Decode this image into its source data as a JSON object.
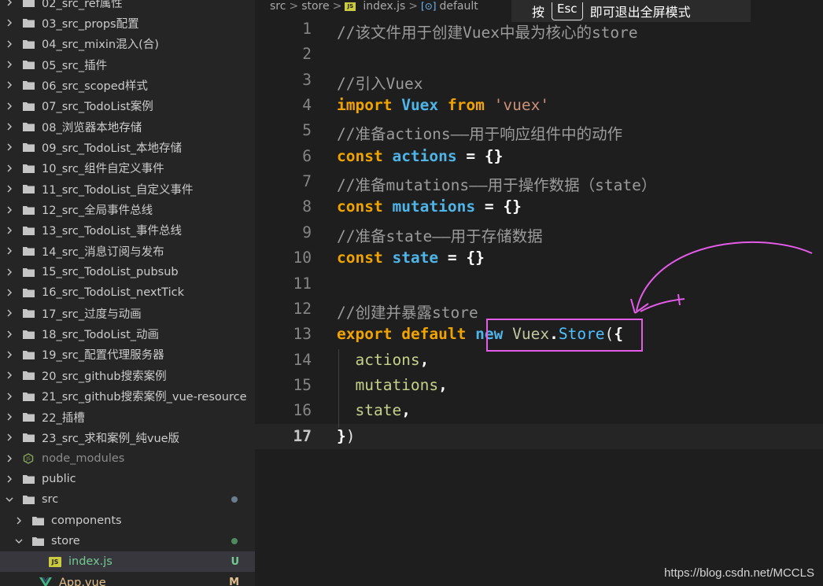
{
  "explorer": {
    "items": [
      {
        "label": "02_src_ref属性",
        "type": "folder",
        "expanded": false
      },
      {
        "label": "03_src_props配置",
        "type": "folder",
        "expanded": false
      },
      {
        "label": "04_src_mixin混入(合)",
        "type": "folder",
        "expanded": false
      },
      {
        "label": "05_src_插件",
        "type": "folder",
        "expanded": false
      },
      {
        "label": "06_src_scoped样式",
        "type": "folder",
        "expanded": false
      },
      {
        "label": "07_src_TodoList案例",
        "type": "folder",
        "expanded": false
      },
      {
        "label": "08_浏览器本地存储",
        "type": "folder",
        "expanded": false
      },
      {
        "label": "09_src_TodoList_本地存储",
        "type": "folder",
        "expanded": false
      },
      {
        "label": "10_src_组件自定义事件",
        "type": "folder",
        "expanded": false
      },
      {
        "label": "11_src_TodoList_自定义事件",
        "type": "folder",
        "expanded": false
      },
      {
        "label": "12_src_全局事件总线",
        "type": "folder",
        "expanded": false
      },
      {
        "label": "13_src_TodoList_事件总线",
        "type": "folder",
        "expanded": false
      },
      {
        "label": "14_src_消息订阅与发布",
        "type": "folder",
        "expanded": false
      },
      {
        "label": "15_src_TodoList_pubsub",
        "type": "folder",
        "expanded": false
      },
      {
        "label": "16_src_TodoList_nextTick",
        "type": "folder",
        "expanded": false
      },
      {
        "label": "17_src_过度与动画",
        "type": "folder",
        "expanded": false
      },
      {
        "label": "18_src_TodoList_动画",
        "type": "folder",
        "expanded": false
      },
      {
        "label": "19_src_配置代理服务器",
        "type": "folder",
        "expanded": false
      },
      {
        "label": "20_src_github搜索案例",
        "type": "folder",
        "expanded": false
      },
      {
        "label": "21_src_github搜索案例_vue-resource",
        "type": "folder",
        "expanded": false
      },
      {
        "label": "22_插槽",
        "type": "folder",
        "expanded": false
      },
      {
        "label": "23_src_求和案例_纯vue版",
        "type": "folder",
        "expanded": false
      },
      {
        "label": "node_modules",
        "type": "folder-special",
        "expanded": false
      },
      {
        "label": "public",
        "type": "folder",
        "expanded": false
      },
      {
        "label": "src",
        "type": "folder",
        "expanded": true,
        "status": "dot"
      },
      {
        "label": "components",
        "type": "folder",
        "expanded": false,
        "depth": 1
      },
      {
        "label": "store",
        "type": "folder",
        "expanded": true,
        "depth": 1,
        "status": "dot-green"
      },
      {
        "label": "index.js",
        "type": "js",
        "depth": 2,
        "badge": "U",
        "selected": true
      },
      {
        "label": "App.vue",
        "type": "vue",
        "depth": 1,
        "badge": "M"
      }
    ],
    "status_colors": {
      "U": "#73c991",
      "M": "#e2c08d",
      "dot": "#6a7d8c",
      "dot-green": "#4f8a5f"
    }
  },
  "breadcrumb": {
    "parts": [
      "src",
      "store",
      "index.js",
      "default"
    ],
    "js_badge": "JS"
  },
  "fullscreen_hint": {
    "before": "按",
    "key": "Esc",
    "after": "即可退出全屏模式"
  },
  "code": {
    "active_line": 17,
    "lines": [
      [
        [
          "comment",
          "//该文件用于创建Vuex中最为核心的store"
        ]
      ],
      [],
      [
        [
          "comment",
          "//引入Vuex"
        ]
      ],
      [
        [
          "kw",
          "import"
        ],
        [
          "plain",
          " "
        ],
        [
          "id",
          "Vuex"
        ],
        [
          "plain",
          " "
        ],
        [
          "kw",
          "from"
        ],
        [
          "plain",
          " "
        ],
        [
          "str",
          "'vuex'"
        ]
      ],
      [
        [
          "comment",
          "//准备actions——用于响应组件中的动作"
        ]
      ],
      [
        [
          "kw",
          "const"
        ],
        [
          "plain",
          " "
        ],
        [
          "id",
          "actions"
        ],
        [
          "plain",
          " "
        ],
        [
          "white",
          "="
        ],
        [
          "plain",
          " "
        ],
        [
          "white",
          "{}"
        ]
      ],
      [
        [
          "comment",
          "//准备mutations——用于操作数据（state）"
        ]
      ],
      [
        [
          "kw",
          "const"
        ],
        [
          "plain",
          " "
        ],
        [
          "id",
          "mutations"
        ],
        [
          "plain",
          " "
        ],
        [
          "white",
          "="
        ],
        [
          "plain",
          " "
        ],
        [
          "white",
          "{}"
        ]
      ],
      [
        [
          "comment",
          "//准备state——用于存储数据"
        ]
      ],
      [
        [
          "kw",
          "const"
        ],
        [
          "plain",
          " "
        ],
        [
          "id",
          "state"
        ],
        [
          "plain",
          " "
        ],
        [
          "white",
          "="
        ],
        [
          "plain",
          " "
        ],
        [
          "white",
          "{}"
        ]
      ],
      [],
      [
        [
          "comment",
          "//创建并暴露store"
        ]
      ],
      [
        [
          "kw",
          "export"
        ],
        [
          "plain",
          " "
        ],
        [
          "kw",
          "default"
        ],
        [
          "plain",
          " "
        ],
        [
          "id",
          "new"
        ],
        [
          "plain",
          " "
        ],
        [
          "stock",
          "Vuex"
        ],
        [
          "white",
          "."
        ],
        [
          "store",
          "Store"
        ],
        [
          "bracket",
          "("
        ],
        [
          "white",
          "{"
        ]
      ],
      [
        [
          "plain",
          "  "
        ],
        [
          "prop",
          "actions"
        ],
        [
          "white",
          ","
        ]
      ],
      [
        [
          "plain",
          "  "
        ],
        [
          "prop",
          "mutations"
        ],
        [
          "white",
          ","
        ]
      ],
      [
        [
          "plain",
          "  "
        ],
        [
          "prop",
          "state"
        ],
        [
          "white",
          ","
        ]
      ],
      [
        [
          "white",
          "}"
        ],
        [
          "bracket",
          ")"
        ]
      ]
    ]
  },
  "watermark": "https://blog.csdn.net/MCCLS",
  "colors": {
    "annotation": "#e25ce8",
    "accent_js": "#cbcb41"
  }
}
